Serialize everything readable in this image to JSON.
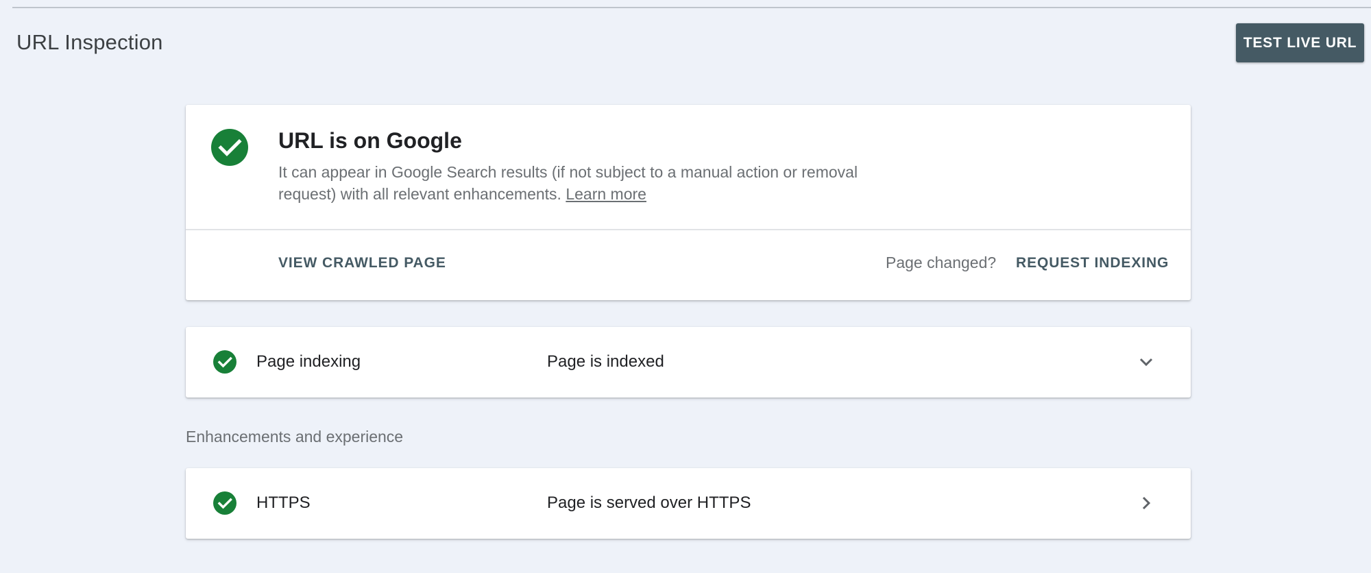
{
  "header": {
    "title": "URL Inspection",
    "test_live_url_label": "TEST LIVE URL"
  },
  "status_card": {
    "icon": "check-circle-icon",
    "heading": "URL is on Google",
    "description": "It can appear in Google Search results (if not subject to a manual action or removal request) with all relevant enhancements.",
    "learn_more_label": "Learn more",
    "view_crawled_label": "VIEW CRAWLED PAGE",
    "page_changed_text": "Page changed?",
    "request_indexing_label": "REQUEST INDEXING"
  },
  "indexing_row": {
    "icon": "check-circle-icon",
    "label": "Page indexing",
    "value": "Page is indexed",
    "chevron": "chevron-down-icon"
  },
  "enhancements": {
    "section_label": "Enhancements and experience",
    "items": [
      {
        "icon": "check-circle-icon",
        "label": "HTTPS",
        "value": "Page is served over HTTPS",
        "chevron": "chevron-right-icon"
      }
    ]
  },
  "colors": {
    "background": "#eef2f9",
    "primary_button": "#455a64",
    "success_green": "#188038",
    "text_primary": "#202124",
    "text_secondary": "#6b6f73"
  }
}
